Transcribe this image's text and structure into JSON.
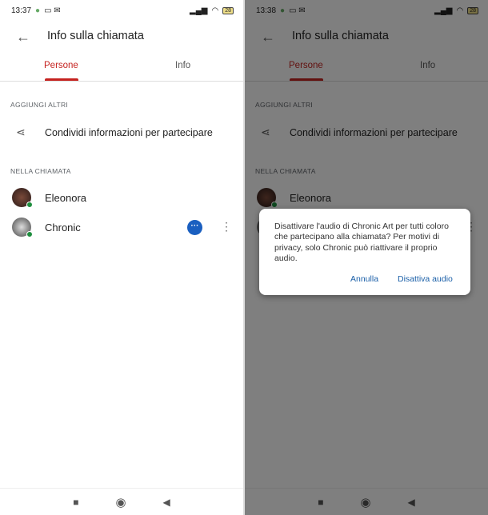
{
  "screens": [
    {
      "time": "13:37",
      "battery": "28"
    },
    {
      "time": "13:38",
      "battery": "28"
    }
  ],
  "header": {
    "title": "Info sulla chiamata",
    "back_icon": "arrow-back-icon"
  },
  "tabs": [
    {
      "label": "Persone",
      "active": true
    },
    {
      "label": "Info"
    }
  ],
  "add_section": {
    "heading": "AGGIUNGI ALTRI",
    "share_label": "Condividi informazioni per partecipare"
  },
  "call_section": {
    "heading": "NELLA CHIAMATA",
    "participants": [
      {
        "name": "Eleonora",
        "status": "online"
      },
      {
        "name": "Chronic",
        "status": "online"
      }
    ]
  },
  "colors": {
    "accent": "#c5221f",
    "button_blue": "#1a5fc0",
    "online": "#1e8e3e"
  },
  "dialog": {
    "text": "Disattivare l'audio di Chronic Art per tutti coloro che partecipano alla chiamata? Per motivi di privacy, solo Chronic può riattivare il proprio audio.",
    "cancel": "Annulla",
    "confirm": "Disattiva audio"
  }
}
